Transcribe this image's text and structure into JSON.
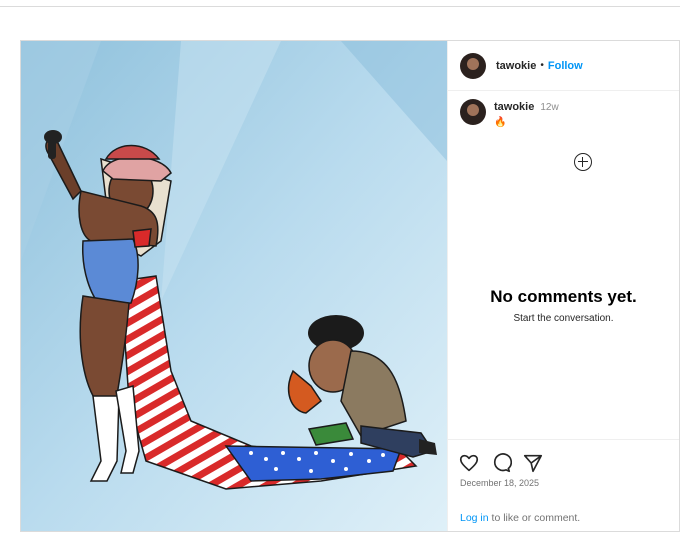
{
  "post": {
    "author": "tawokie",
    "follow_label": "Follow",
    "separator": "•"
  },
  "comment": {
    "author": "tawokie",
    "time": "12w",
    "text": "🔥"
  },
  "empty_state": {
    "title": "No comments yet.",
    "subtitle": "Start the conversation."
  },
  "footer": {
    "date": "December 18, 2025",
    "login_link": "Log in",
    "login_suffix": " to like or comment."
  },
  "icons": [
    "heart-icon",
    "comment-icon",
    "share-icon",
    "add-comment-icon"
  ],
  "colors": {
    "link": "#0095f6",
    "border": "#dbdbdb",
    "muted": "#737373"
  }
}
